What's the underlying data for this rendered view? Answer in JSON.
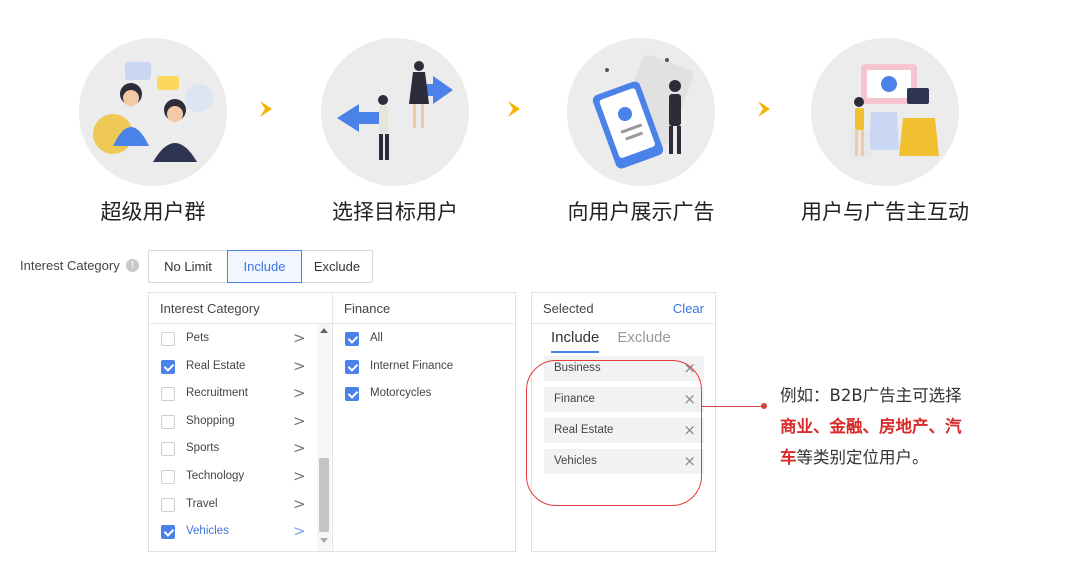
{
  "flow": {
    "steps": [
      {
        "title": "超级用户群",
        "icon": "user-group-illustration-icon"
      },
      {
        "title": "选择目标用户",
        "icon": "target-user-illustration-icon"
      },
      {
        "title": "向用户展示广告",
        "icon": "show-ad-illustration-icon"
      },
      {
        "title": "用户与广告主互动",
        "icon": "interaction-illustration-icon"
      }
    ],
    "arrow_color": "#f5b400",
    "circle_color": "#ececec"
  },
  "filter": {
    "label": "Interest Category",
    "options": [
      "No Limit",
      "Include",
      "Exclude"
    ],
    "active": "Include"
  },
  "category_panel": {
    "left_header": "Interest Category",
    "right_header": "Finance",
    "categories": [
      {
        "label": "Pets",
        "checked": false
      },
      {
        "label": "Real Estate",
        "checked": true
      },
      {
        "label": "Recruitment",
        "checked": false
      },
      {
        "label": "Shopping",
        "checked": false
      },
      {
        "label": "Sports",
        "checked": false
      },
      {
        "label": "Technology",
        "checked": false
      },
      {
        "label": "Travel",
        "checked": false
      },
      {
        "label": "Vehicles",
        "checked": true
      }
    ],
    "finance_items": [
      {
        "label": "All",
        "checked": true
      },
      {
        "label": "Internet Finance",
        "checked": true
      },
      {
        "label": "Motorcycles",
        "checked": true
      }
    ]
  },
  "selected_panel": {
    "header": "Selected",
    "clear": "Clear",
    "tabs": [
      "Include",
      "Exclude"
    ],
    "active_tab": "Include",
    "tags": [
      "Business",
      "Finance",
      "Real Estate",
      "Vehicles"
    ]
  },
  "annotation": {
    "line1": "例如：B2B广告主可选择",
    "highlight1": "商业、金融、房地产、汽",
    "highlight2": "车",
    "tail": "等类别定位用户。",
    "highlight_color": "#d92a2a"
  },
  "colors": {
    "accent": "#4a82ea",
    "annotation_red": "#d0443c"
  }
}
